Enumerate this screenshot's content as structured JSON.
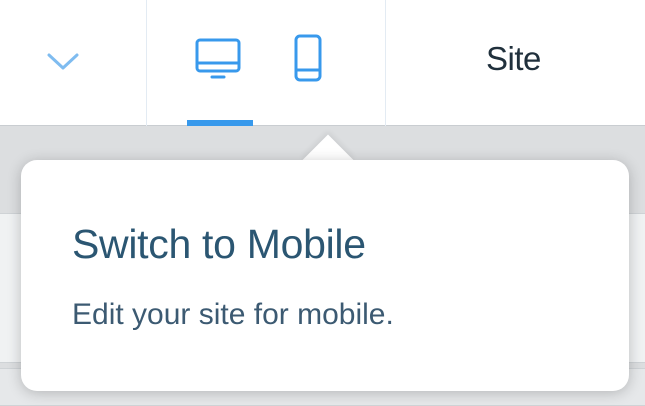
{
  "topbar": {
    "site_menu_label": "Site",
    "icons": {
      "dropdown": "chevron-down-icon",
      "desktop": "desktop-icon",
      "mobile": "mobile-icon"
    },
    "active_device": "desktop"
  },
  "tooltip": {
    "title": "Switch to Mobile",
    "description": "Edit your site for mobile."
  },
  "colors": {
    "accent": "#3899ec",
    "title_text": "#2b5672",
    "body_text": "#3c5a72",
    "label_text": "#20303c"
  }
}
